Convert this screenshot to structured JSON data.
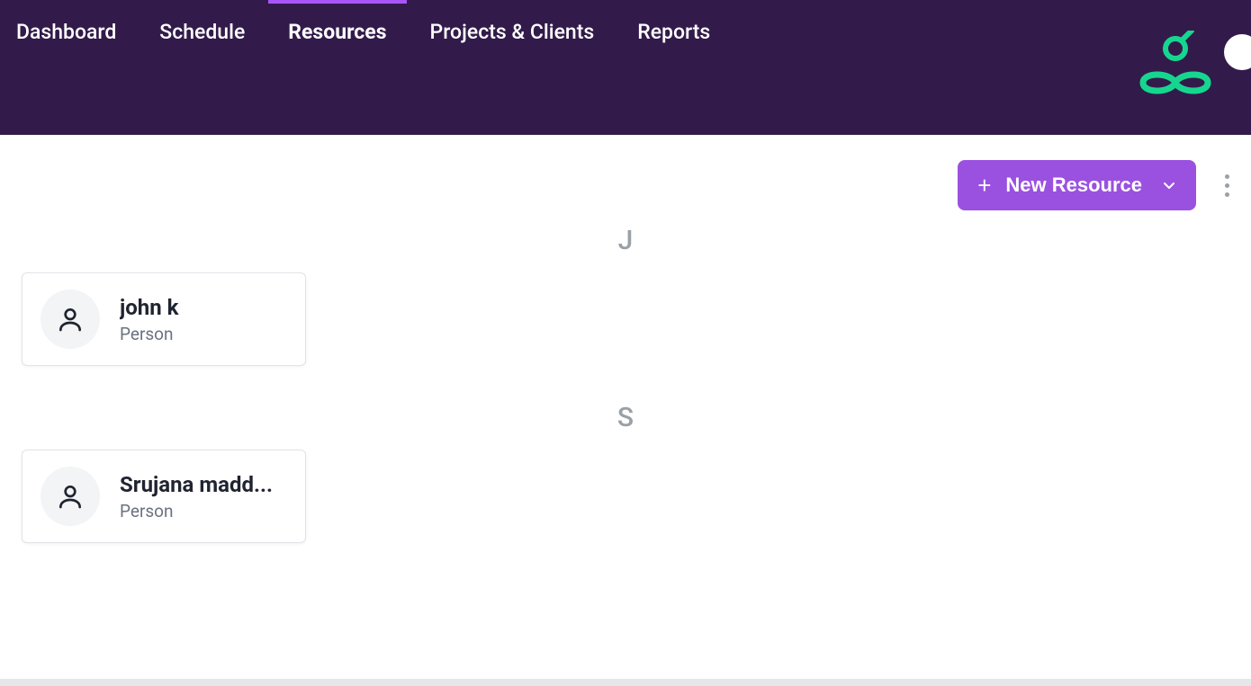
{
  "nav": {
    "tabs": [
      {
        "label": "Dashboard",
        "active": false
      },
      {
        "label": "Schedule",
        "active": false
      },
      {
        "label": "Resources",
        "active": true
      },
      {
        "label": "Projects & Clients",
        "active": false
      },
      {
        "label": "Reports",
        "active": false
      }
    ]
  },
  "toolbar": {
    "new_resource_label": "New Resource"
  },
  "groups": [
    {
      "letter": "J",
      "cards": [
        {
          "name": "john k",
          "type": "Person"
        }
      ]
    },
    {
      "letter": "S",
      "cards": [
        {
          "name": "Srujana madd...",
          "type": "Person"
        }
      ]
    }
  ],
  "colors": {
    "header_bg": "#321b4a",
    "accent": "#9b51e0",
    "tab_indicator": "#a855f7",
    "logo_green": "#16d68f"
  }
}
